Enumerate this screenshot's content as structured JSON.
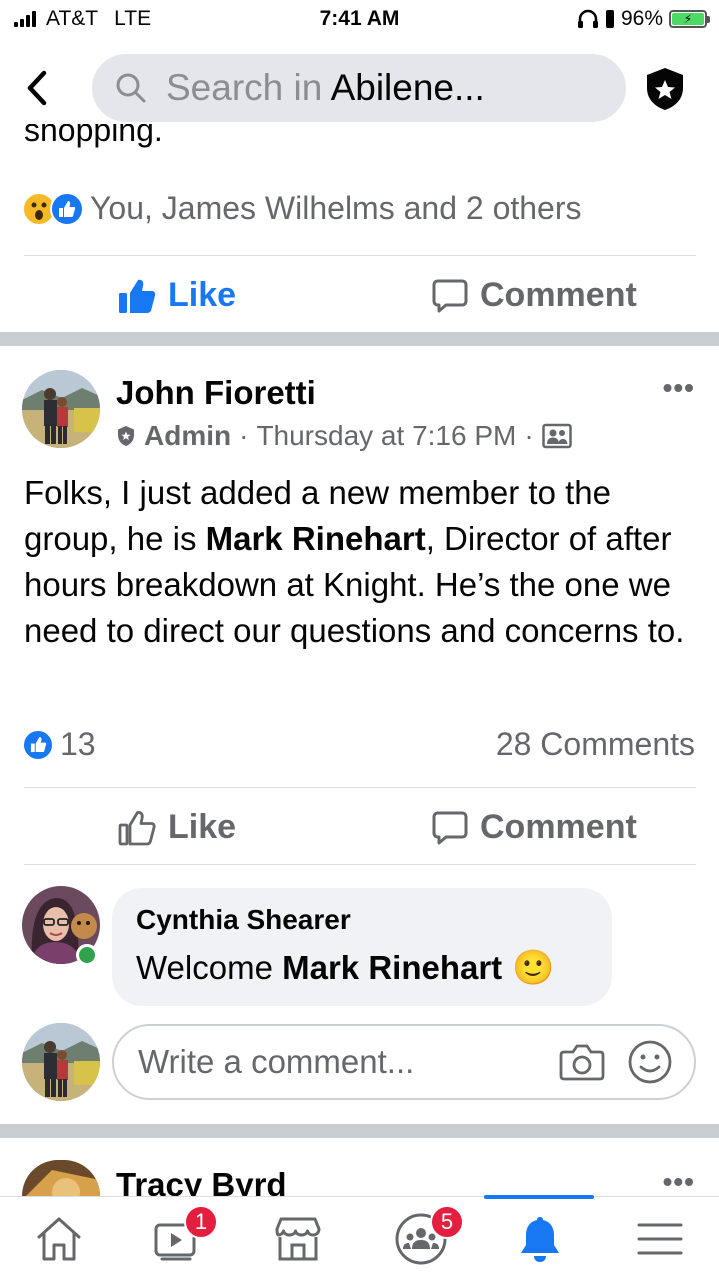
{
  "status_bar": {
    "carrier": "AT&T",
    "network": "LTE",
    "time": "7:41 AM",
    "battery_percent": "96%"
  },
  "header": {
    "search_prefix": "Search in",
    "search_group": "Abilene...",
    "back_icon": "chevron-left-icon",
    "admin_icon": "shield-star-icon"
  },
  "previous_post": {
    "clipped_text": "shopping.",
    "reactions_summary": "You, James Wilhelms and 2 others",
    "like_label": "Like",
    "comment_label": "Comment",
    "like_active": true
  },
  "post": {
    "author": "John Fioretti",
    "role": "Admin",
    "separator": "·",
    "timestamp": "Thursday at 7:16 PM",
    "body_1": "Folks, I just added a new member to the group, he is ",
    "body_bold": "Mark Rinehart",
    "body_2": ", Director of after hours breakdown at Knight. He’s the one we need to direct our questions and concerns to.",
    "like_count": "13",
    "comments_count": "28 Comments",
    "like_label": "Like",
    "comment_label": "Comment"
  },
  "comment": {
    "author": "Cynthia Shearer",
    "text_prefix": "Welcome ",
    "text_bold": "Mark Rinehart",
    "emoji": "🙂"
  },
  "write_comment": {
    "placeholder": "Write a comment..."
  },
  "next_post": {
    "author": "Tracy Byrd"
  },
  "tab_bar": {
    "watch_badge": "1",
    "groups_badge": "5",
    "active_tab": "notifications"
  },
  "colors": {
    "accent": "#1877f2",
    "badge": "#e41e3f",
    "online": "#31a24c"
  }
}
